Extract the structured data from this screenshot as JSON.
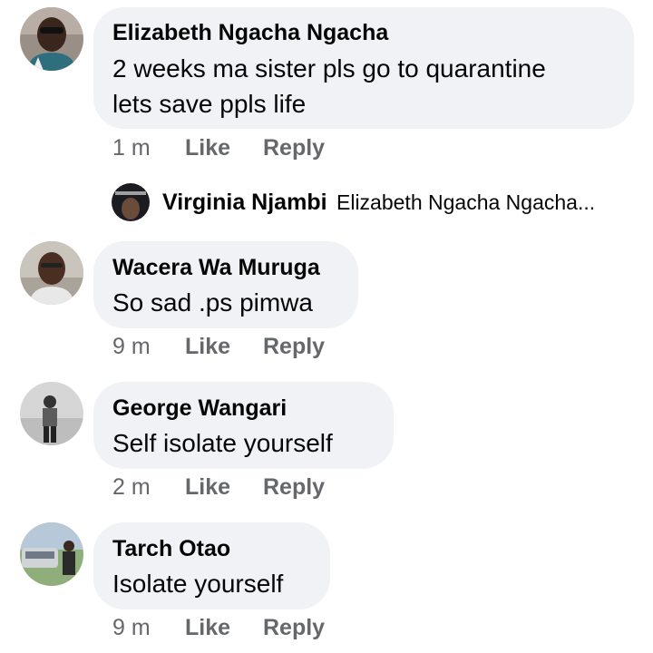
{
  "comments": [
    {
      "author": "Elizabeth Ngacha Ngacha",
      "text_lines": [
        "2 weeks ma sister pls go to quarantine",
        "lets save ppls life"
      ],
      "time": "1 m",
      "like_label": "Like",
      "reply_label": "Reply"
    },
    {
      "author": "Wacera Wa Muruga",
      "text_lines": [
        "So sad .ps pimwa"
      ],
      "time": "9 m",
      "like_label": "Like",
      "reply_label": "Reply"
    },
    {
      "author": "George Wangari",
      "text_lines": [
        "Self isolate yourself"
      ],
      "time": "2 m",
      "like_label": "Like",
      "reply_label": "Reply"
    },
    {
      "author": "Tarch Otao",
      "text_lines": [
        "Isolate yourself"
      ],
      "time": "9 m",
      "like_label": "Like",
      "reply_label": "Reply"
    }
  ],
  "reply_preview": {
    "author": "Virginia Njambi",
    "text": "Elizabeth Ngacha Ngacha..."
  },
  "colors": {
    "bubble": "#f0f2f5",
    "meta_text": "#65676b",
    "primary_text": "#050505"
  }
}
